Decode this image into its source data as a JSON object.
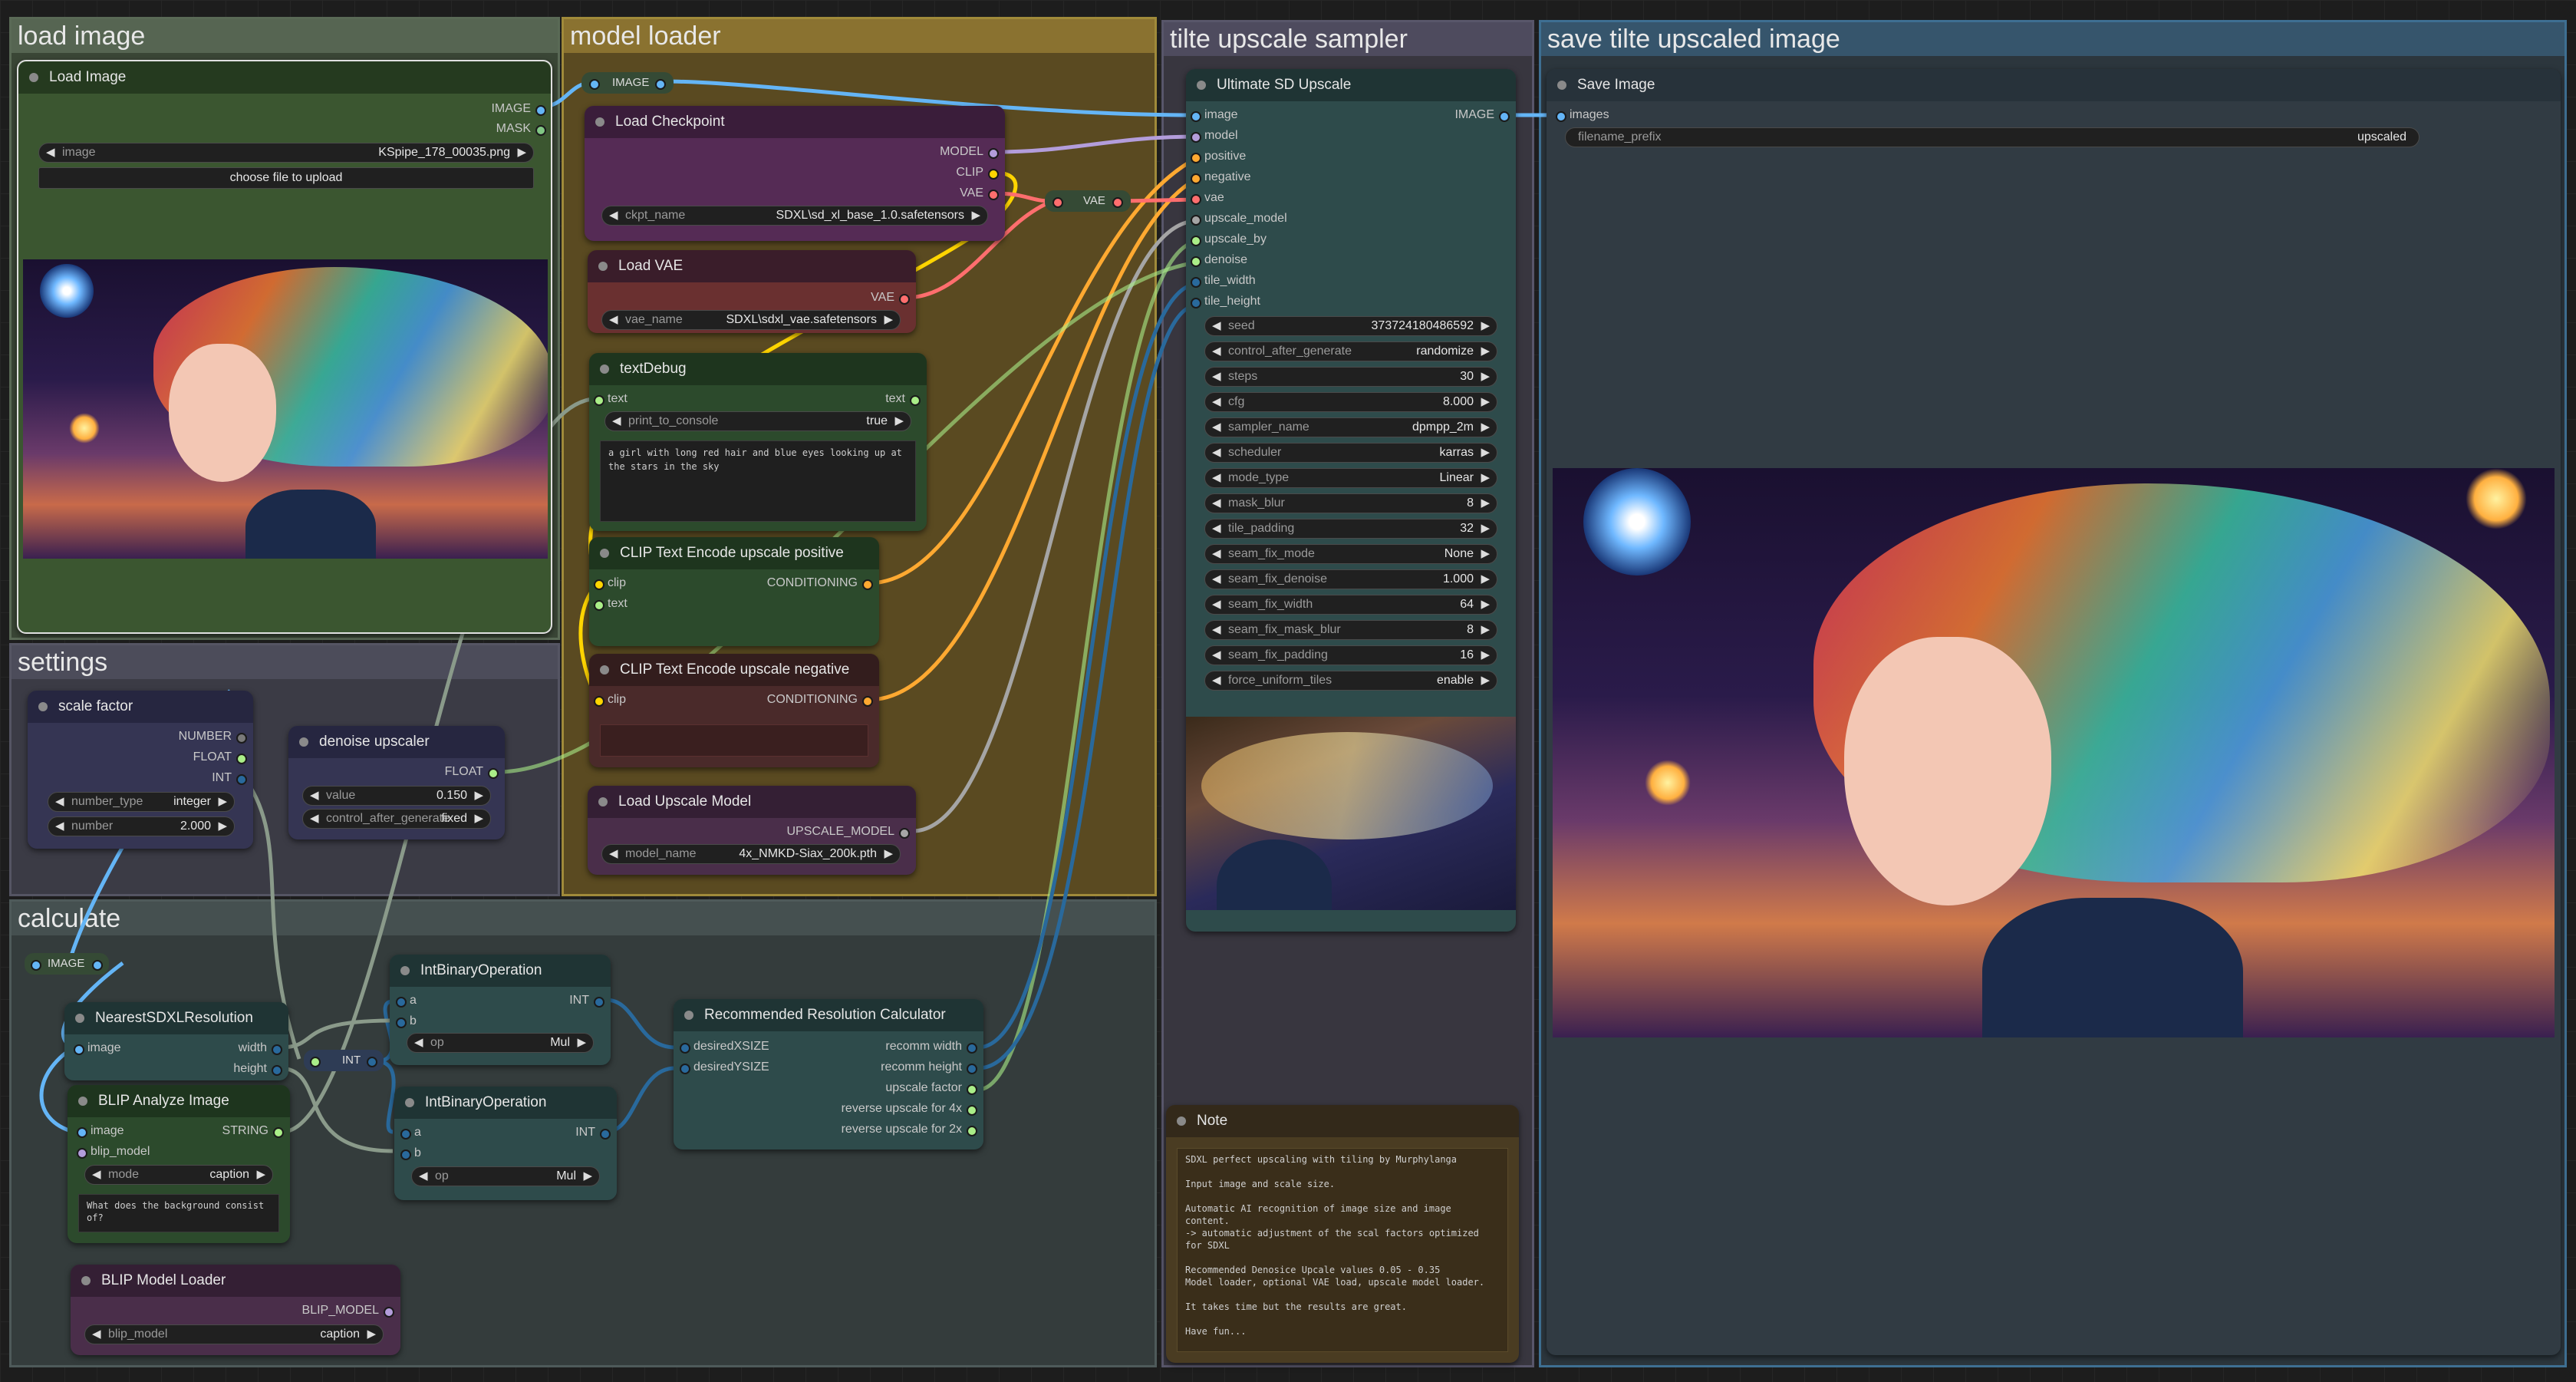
{
  "groups": {
    "load_image": "load image",
    "model_loader": "model loader",
    "tile_sampler": "tilte upscale sampler",
    "save": "save tilte upscaled image",
    "settings": "settings",
    "calculate": "calculate"
  },
  "load_image_node": {
    "title": "Load Image",
    "out_image": "IMAGE",
    "out_mask": "MASK",
    "image_label": "image",
    "image_value": "KSpipe_178_00035.png",
    "upload_button": "choose file to upload"
  },
  "reroute_image": "IMAGE",
  "checkpoint": {
    "title": "Load Checkpoint",
    "out_model": "MODEL",
    "out_clip": "CLIP",
    "out_vae": "VAE",
    "ckpt_label": "ckpt_name",
    "ckpt_value": "SDXL\\sd_xl_base_1.0.safetensors"
  },
  "reroute_vae": "VAE",
  "load_vae": {
    "title": "Load VAE",
    "out_vae": "VAE",
    "vae_label": "vae_name",
    "vae_value": "SDXL\\sdxl_vae.safetensors"
  },
  "text_debug": {
    "title": "textDebug",
    "in_text": "text",
    "out_text": "text",
    "print_label": "print_to_console",
    "print_value": "true",
    "content": "a girl with long red hair and blue eyes looking up at the stars in the sky"
  },
  "clip_pos": {
    "title": "CLIP Text Encode upscale positive",
    "in_clip": "clip",
    "in_text": "text",
    "out": "CONDITIONING"
  },
  "clip_neg": {
    "title": "CLIP Text Encode upscale negative",
    "in_clip": "clip",
    "out": "CONDITIONING"
  },
  "upscale_loader": {
    "title": "Load Upscale Model",
    "out": "UPSCALE_MODEL",
    "model_label": "model_name",
    "model_value": "4x_NMKD-Siax_200k.pth"
  },
  "sampler": {
    "title": "Ultimate SD Upscale",
    "out_image": "IMAGE",
    "inputs": [
      "image",
      "model",
      "positive",
      "negative",
      "vae",
      "upscale_model",
      "upscale_by",
      "denoise",
      "tile_width",
      "tile_height"
    ],
    "widgets": [
      {
        "label": "seed",
        "value": "373724180486592"
      },
      {
        "label": "control_after_generate",
        "value": "randomize"
      },
      {
        "label": "steps",
        "value": "30"
      },
      {
        "label": "cfg",
        "value": "8.000"
      },
      {
        "label": "sampler_name",
        "value": "dpmpp_2m"
      },
      {
        "label": "scheduler",
        "value": "karras"
      },
      {
        "label": "mode_type",
        "value": "Linear"
      },
      {
        "label": "mask_blur",
        "value": "8"
      },
      {
        "label": "tile_padding",
        "value": "32"
      },
      {
        "label": "seam_fix_mode",
        "value": "None"
      },
      {
        "label": "seam_fix_denoise",
        "value": "1.000"
      },
      {
        "label": "seam_fix_width",
        "value": "64"
      },
      {
        "label": "seam_fix_mask_blur",
        "value": "8"
      },
      {
        "label": "seam_fix_padding",
        "value": "16"
      },
      {
        "label": "force_uniform_tiles",
        "value": "enable"
      }
    ]
  },
  "save_node": {
    "title": "Save Image",
    "in_images": "images",
    "prefix_label": "filename_prefix",
    "prefix_value": "upscaled"
  },
  "note": {
    "title": "Note",
    "content": "SDXL perfect upscaling with tiling by Murphylanga\n\nInput image and scale size.\n\nAutomatic AI recognition of image size and image content.\n-> automatic adjustment of the scal factors optimized for SDXL\n\nRecommended Denosice Upcale values 0.05 - 0.35\nModel loader, optional VAE load, upscale model loader.\n\nIt takes time but the results are great.\n\nHave fun..."
  },
  "scale_factor": {
    "title": "scale factor",
    "out_number": "NUMBER",
    "out_float": "FLOAT",
    "out_int": "INT",
    "type_label": "number_type",
    "type_value": "integer",
    "number_label": "number",
    "number_value": "2.000"
  },
  "denoise": {
    "title": "denoise upscaler",
    "out_float": "FLOAT",
    "value_label": "value",
    "value_value": "0.150",
    "control_label": "control_after_generate",
    "control_value": "fixed"
  },
  "reroute_calc_image": "IMAGE",
  "nearest": {
    "title": "NearestSDXLResolution",
    "in_image": "image",
    "out_width": "width",
    "out_height": "height"
  },
  "reroute_int": "INT",
  "intop1": {
    "title": "IntBinaryOperation",
    "in_a": "a",
    "in_b": "b",
    "out": "INT",
    "op_label": "op",
    "op_value": "Mul"
  },
  "intop2": {
    "title": "IntBinaryOperation",
    "in_a": "a",
    "in_b": "b",
    "out": "INT",
    "op_label": "op",
    "op_value": "Mul"
  },
  "recommended": {
    "title": "Recommended Resolution Calculator",
    "in_x": "desiredXSIZE",
    "in_y": "desiredYSIZE",
    "outs": [
      "recomm width",
      "recomm height",
      "upscale factor",
      "reverse upscale for 4x",
      "reverse upscale for 2x"
    ]
  },
  "blip_analyze": {
    "title": "BLIP Analyze Image",
    "in_image": "image",
    "in_model": "blip_model",
    "out": "STRING",
    "mode_label": "mode",
    "mode_value": "caption",
    "question": "What does the background consist of?"
  },
  "blip_loader": {
    "title": "BLIP Model Loader",
    "out": "BLIP_MODEL",
    "model_label": "blip_model",
    "model_value": "caption"
  },
  "colors": {
    "image_pin": "#64b5f6",
    "model_pin": "#b39ddb",
    "clip_pin": "#ffd500",
    "vae_pin": "#ff6e6e",
    "cond_pin": "#ffa931",
    "float_pin": "#aaee88",
    "int_pin": "#29699c"
  }
}
